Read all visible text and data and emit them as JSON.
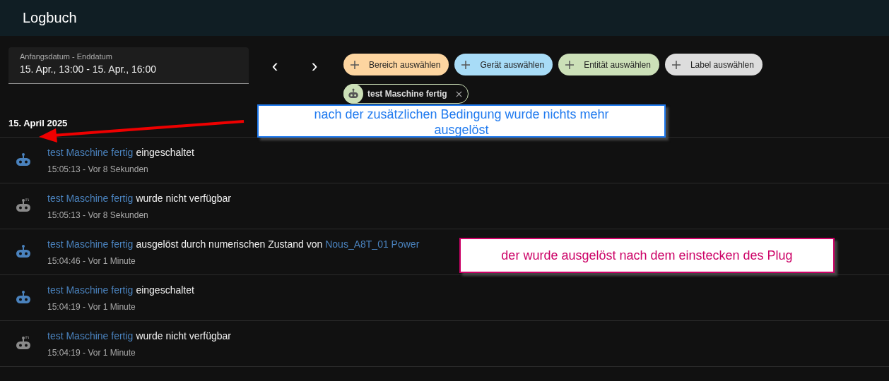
{
  "header": {
    "title": "Logbuch"
  },
  "date_range": {
    "label": "Anfangsdatum - Enddatum",
    "value": "15. Apr., 13:00 - 15. Apr., 16:00"
  },
  "nav": [
    "‹",
    "›"
  ],
  "target_chips": [
    {
      "label": "Bereich auswählen",
      "color": "#fdd5a0"
    },
    {
      "label": "Gerät auswählen",
      "color": "#a8dcf7"
    },
    {
      "label": "Entität auswählen",
      "color": "#cce0b8"
    },
    {
      "label": "Label auswählen",
      "color": "#dddddd"
    }
  ],
  "selected_entities": [
    {
      "label": "test Maschine fertig"
    }
  ],
  "day_heading": "15. April 2025",
  "entries": [
    {
      "kind": "on",
      "entity": "test Maschine fertig",
      "message": "eingeschaltet",
      "time": "15:05:13 - Vor 8 Sekunden"
    },
    {
      "kind": "unavailable",
      "entity": "test Maschine fertig",
      "message": "wurde nicht verfügbar",
      "time": "15:05:13 - Vor 8 Sekunden"
    },
    {
      "kind": "on",
      "entity": "test Maschine fertig",
      "message": "ausgelöst durch numerischen Zustand von",
      "link": "Nous_A8T_01 Power",
      "time": "15:04:46 - Vor 1 Minute"
    },
    {
      "kind": "on",
      "entity": "test Maschine fertig",
      "message": "eingeschaltet",
      "time": "15:04:19 - Vor 1 Minute"
    },
    {
      "kind": "unavailable",
      "entity": "test Maschine fertig",
      "message": "wurde nicht verfügbar",
      "time": "15:04:19 - Vor 1 Minute"
    }
  ],
  "annotations": [
    {
      "kind": "blue",
      "text": "nach der zusätzlichen Bedingung wurde nichts mehr ausgelöst"
    },
    {
      "kind": "pink",
      "text": "der wurde ausgelöst nach dem einstecken des Plug"
    }
  ]
}
